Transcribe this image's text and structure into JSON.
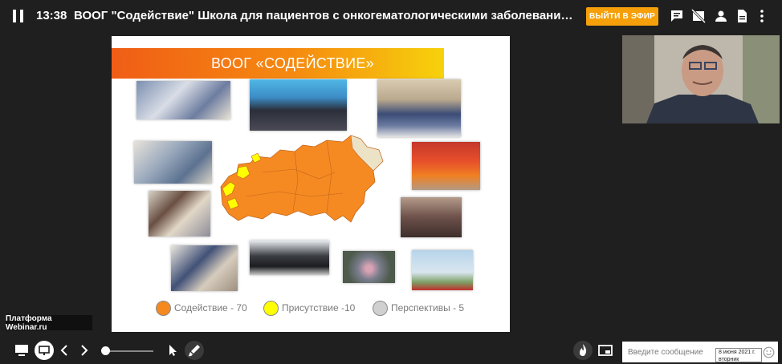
{
  "header": {
    "time": "13:38",
    "title": "ВООГ \"Содействие\"   Школа для пациентов с онкогематологическими заболеваниями («Трансплан…",
    "exit_button": "ВЫЙТИ В ЭФИР",
    "icons": [
      "pause-icon",
      "chat-icon",
      "camera-off-icon",
      "participant-icon",
      "document-icon",
      "more-vertical-icon"
    ]
  },
  "slide": {
    "title": "ВООГ «СОДЕЙСТВИЕ»",
    "legend": [
      {
        "label": "Содействие - 70",
        "color": "#f5891f"
      },
      {
        "label": "Присутствие -10",
        "color": "#ffff00"
      },
      {
        "label": "Перспективы - 5",
        "color": "#d0d0d0"
      }
    ]
  },
  "watermark": "Платформа Webinar.ru",
  "footer": {
    "message_placeholder": "Введите сообщение",
    "date_tooltip": [
      "8 июня 2021 г.",
      "вторник"
    ]
  }
}
